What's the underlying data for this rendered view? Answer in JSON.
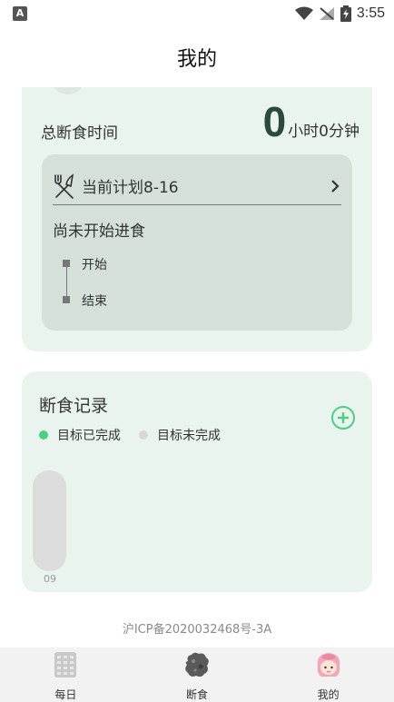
{
  "status_bar": {
    "time": "3:55"
  },
  "header": {
    "title": "我的"
  },
  "summary": {
    "total_label": "总断食时间",
    "total_value": "0",
    "total_unit": "小时0分钟"
  },
  "plan": {
    "current_plan": "当前计划8-16",
    "status": "尚未开始进食",
    "start_label": "开始",
    "end_label": "结束"
  },
  "records": {
    "title": "断食记录",
    "legend_done": "目标已完成",
    "legend_undone": "目标未完成",
    "bar_label": "09"
  },
  "footer": {
    "icp": "沪ICP备2020032468号-3A"
  },
  "tabs": [
    {
      "label": "每日",
      "icon": "calendar-icon"
    },
    {
      "label": "断食",
      "icon": "fasting-icon"
    },
    {
      "label": "我的",
      "icon": "profile-avatar-icon"
    }
  ],
  "colors": {
    "card_bg": "#eaf4ee",
    "plan_bg": "#d5e0d9",
    "accent_green": "#4ccf83",
    "dark_green": "#2c4a3c"
  }
}
